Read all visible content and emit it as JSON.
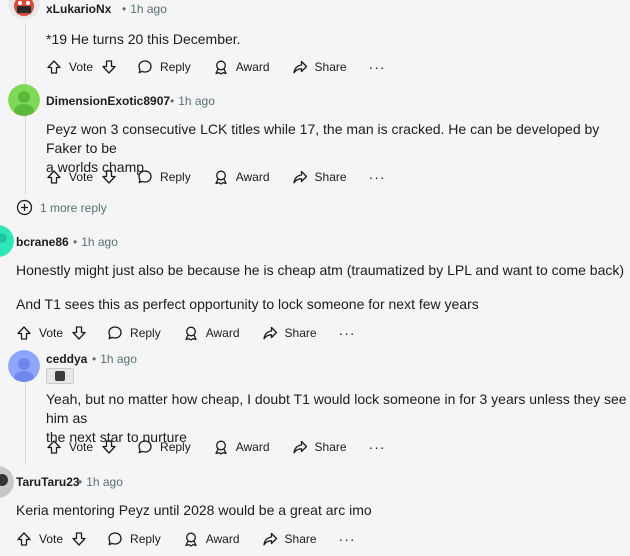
{
  "comments": [
    {
      "author": "xLukarioNx",
      "time": "1h ago",
      "lines": [
        "*19 He turns 20 this December."
      ],
      "avatar_color": "#d94b3b"
    },
    {
      "author": "DimensionExotic8907",
      "time": "1h ago",
      "lines": [
        "Peyz won 3 consecutive LCK titles while 17, the man is cracked. He can be developed by Faker to be",
        "a worlds champ."
      ],
      "avatar_color": "#7ed957"
    },
    {
      "author": "bcrane86",
      "time": "1h ago",
      "lines": [
        "Honestly might just also be because he is cheap atm (traumatized by LPL and want to come back)",
        "And T1 sees this as perfect opportunity to lock someone for next few years"
      ],
      "avatar_color": "#2ee6b8"
    },
    {
      "author": "ceddya",
      "time": "1h ago",
      "lines": [
        "Yeah, but no matter how cheap, I doubt T1 would lock someone in for 3 years unless they see him as",
        "the next star to nurture"
      ],
      "avatar_color": "#8fa6ff"
    },
    {
      "author": "TaruTaru23",
      "time": "1h ago",
      "lines": [
        "Keria mentoring Peyz until 2028 would be a great arc imo"
      ],
      "avatar_color": "#c7c7c7"
    }
  ],
  "actions": {
    "vote": "Vote",
    "reply": "Reply",
    "award": "Award",
    "share": "Share",
    "more": "···"
  },
  "more_replies": "1 more reply",
  "separator": "•"
}
